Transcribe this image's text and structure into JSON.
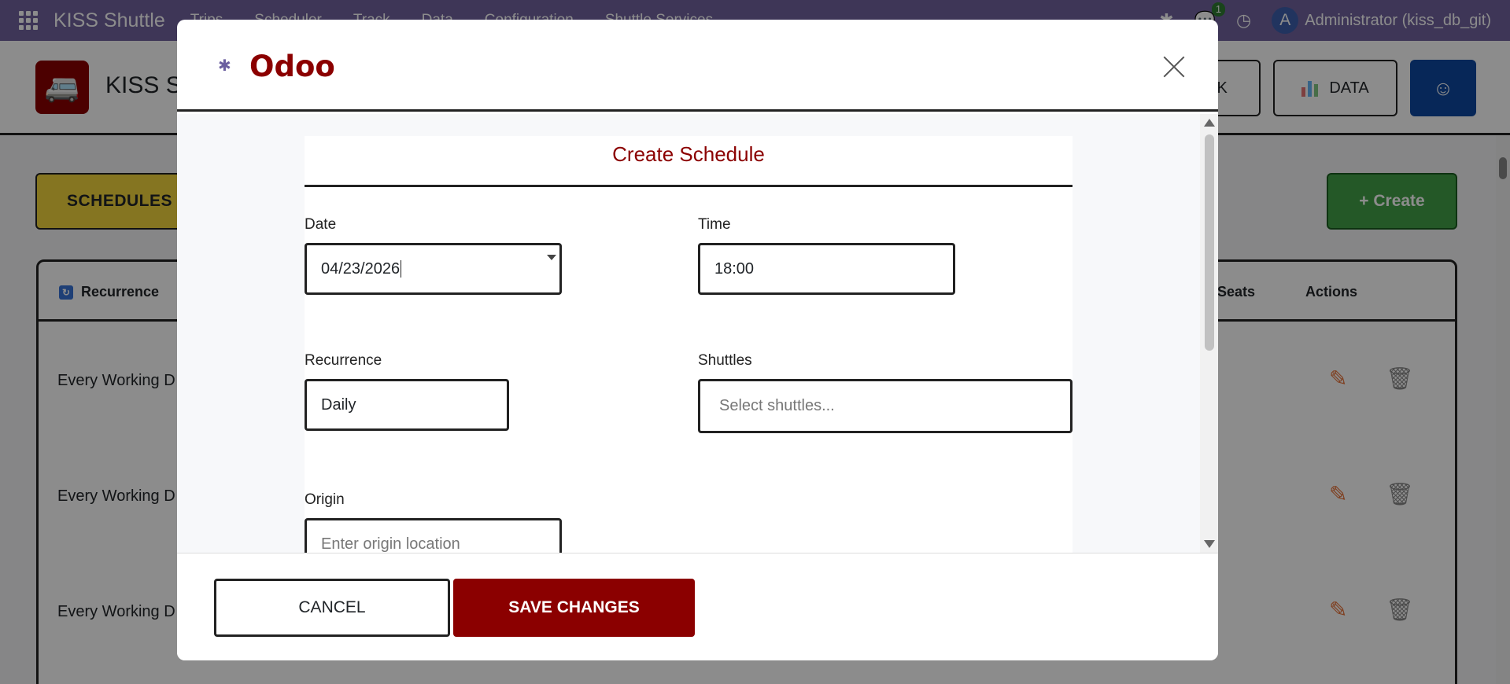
{
  "nav": {
    "brand": "KISS Shuttle",
    "menu": [
      "Trips",
      "Scheduler",
      "Track",
      "Data",
      "Configuration",
      "Shuttle Services"
    ],
    "chat_badge": "1",
    "user_initial": "A",
    "user_name": "Administrator (kiss_db_git)"
  },
  "control": {
    "app_title": "KISS Sh",
    "track_label": "CK",
    "data_label": "DATA"
  },
  "main": {
    "schedules_label": "SCHEDULES",
    "create_label": "+ Create",
    "columns": {
      "recurrence": "Recurrence",
      "seats": "Seats",
      "actions": "Actions"
    },
    "rows": [
      "Every Working D",
      "Every Working D",
      "Every Working D"
    ]
  },
  "modal": {
    "title": "Odoo",
    "form_title": "Create Schedule",
    "date": {
      "label": "Date",
      "value": "04/23/2026"
    },
    "time": {
      "label": "Time",
      "value": "18:00"
    },
    "recurrence": {
      "label": "Recurrence",
      "value": "Daily"
    },
    "shuttles": {
      "label": "Shuttles",
      "placeholder": "Select shuttles..."
    },
    "origin": {
      "label": "Origin",
      "placeholder": "Enter origin location"
    },
    "cancel_label": "CANCEL",
    "save_label": "SAVE CHANGES"
  },
  "colors": {
    "nav_bg": "#71639e",
    "brand_red": "#8b0000",
    "schedules_yellow": "#f2d53c",
    "create_green": "#43a047",
    "user_blue": "#0d47a1"
  },
  "icons": [
    "apps-grid-icon",
    "bug-icon",
    "chat-icon",
    "clock-icon",
    "bus-icon",
    "chart-icon",
    "user-icon",
    "sort-icon",
    "edit-icon",
    "trash-icon",
    "close-icon",
    "dropdown-caret-icon"
  ]
}
